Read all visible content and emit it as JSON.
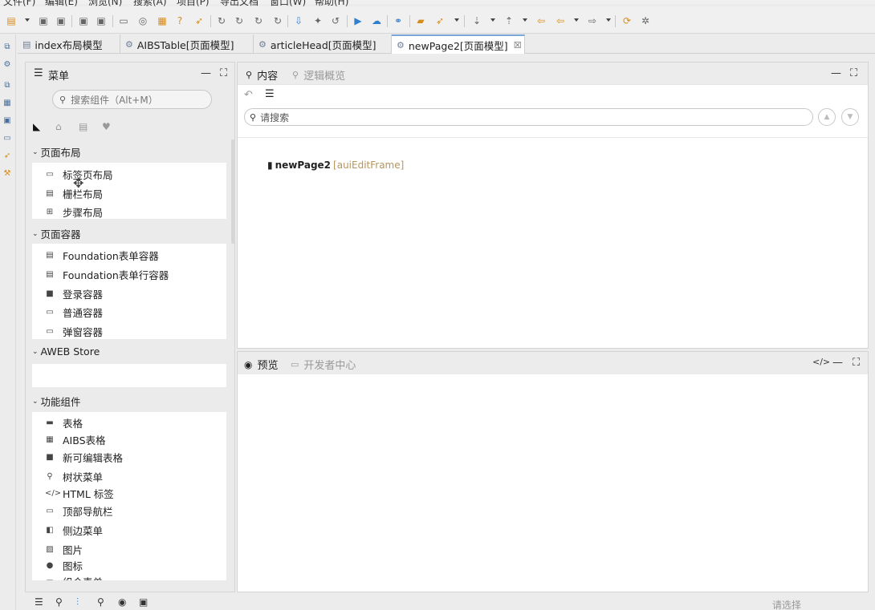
{
  "menubar": {
    "items": [
      "文件(F)",
      "编辑(E)",
      "浏览(N)",
      "搜索(A)",
      "项目(P)",
      "导出文档",
      "窗口(W)",
      "帮助(H)"
    ]
  },
  "editor_tabs": [
    {
      "label": "index布局模型",
      "active": false
    },
    {
      "label": "AIBSTable[页面模型]",
      "active": false
    },
    {
      "label": "articleHead[页面模型]",
      "active": false
    },
    {
      "label": "newPage2[页面模型]",
      "active": true,
      "close": "☒"
    }
  ],
  "sidebar": {
    "title": "菜单",
    "search_placeholder": "搜索组件（Alt+M）",
    "groups": [
      {
        "label": "页面布局",
        "items": [
          "标签页布局",
          "栅栏布局",
          "步骤布局"
        ]
      },
      {
        "label": "页面容器",
        "items": [
          "Foundation表单容器",
          "Foundation表单行容器",
          "登录容器",
          "普通容器",
          "弹窗容器"
        ]
      },
      {
        "label": "AWEB Store",
        "items": []
      },
      {
        "label": "功能组件",
        "items": [
          "表格",
          "AIBS表格",
          "新可编辑表格",
          "树状菜单",
          "HTML 标签",
          "顶部导航栏",
          "侧边菜单",
          "图片",
          "图标",
          "组合表单"
        ]
      }
    ]
  },
  "content": {
    "tab_active": "内容",
    "tab_inactive": "逻辑概览",
    "search_placeholder": "请搜索",
    "tree_node": {
      "name": "newPage2",
      "type": "[auiEditFrame]"
    }
  },
  "preview": {
    "tab_active": "预览",
    "tab_inactive": "开发者中心"
  },
  "statusbar": {
    "hint": "请选择"
  },
  "colors": {
    "accent": "#2f7fd1",
    "node_type": "#b5945c",
    "active_tab_border": "#7aa7d8"
  }
}
